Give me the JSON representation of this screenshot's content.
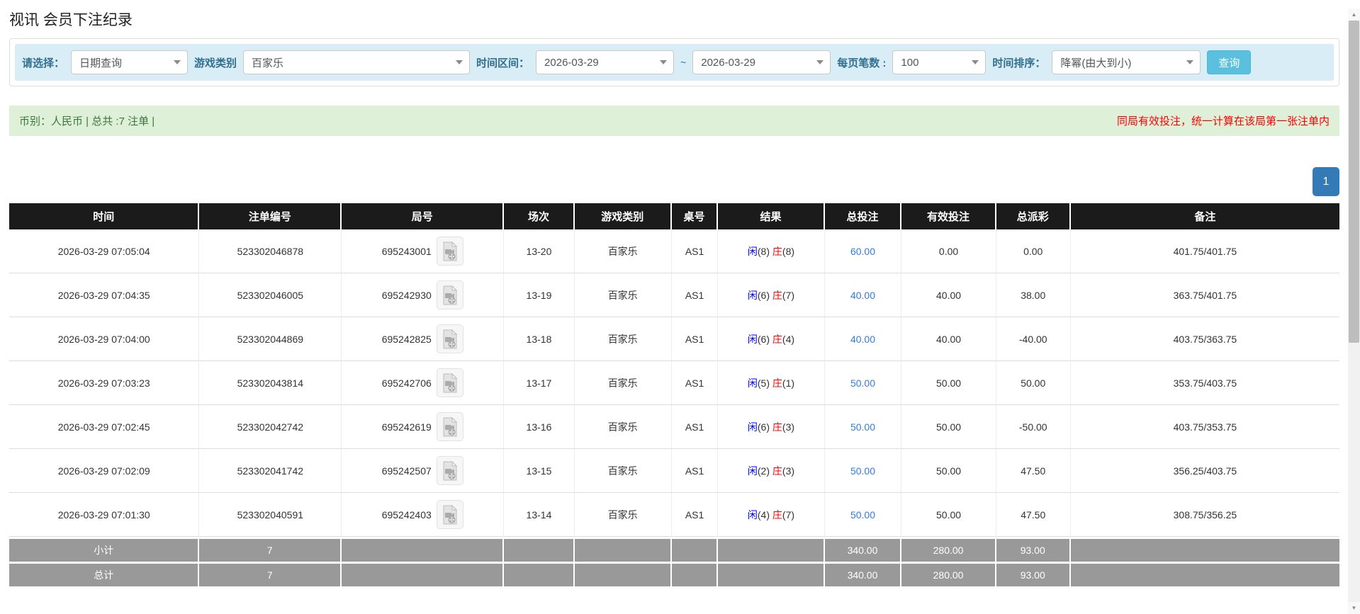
{
  "page_title": "视讯 会员下注纪录",
  "filters": {
    "query_type": {
      "label": "请选择：",
      "value": "日期查询"
    },
    "game_category": {
      "label": "游戏类别",
      "value": "百家乐"
    },
    "date_range": {
      "label": "时间区间：",
      "from": "2026-03-29",
      "separator": "~",
      "to": "2026-03-29"
    },
    "page_size": {
      "label": "每页笔数 :",
      "value": "100"
    },
    "time_sort": {
      "label": "时间排序：",
      "value": "降幂(由大到小)"
    },
    "search_button": "查询"
  },
  "summary": {
    "currency_text": "币别：人民币 | 总共 :7 注单 |",
    "notice": "同局有效投注，统一计算在该局第一张注单内"
  },
  "pagination": {
    "current_page": "1"
  },
  "colors": {
    "accent_blue": "#337ab7",
    "search_button_blue": "#5bc0de",
    "player_blue": "#0000ff",
    "banker_red": "#ff0000",
    "negative_red": "#ff0000",
    "success_green": "#3c763d",
    "header_black": "#1b1b1b",
    "totals_gray": "#999999",
    "filter_bar_blue": "#d9edf7",
    "summary_bar_green": "#dff0d8"
  },
  "table": {
    "columns": [
      "时间",
      "注单编号",
      "局号",
      "场次",
      "游戏类别",
      "桌号",
      "结果",
      "总投注",
      "有效投注",
      "总派彩",
      "备注"
    ],
    "result_labels": {
      "player": "闲",
      "banker": "庄"
    },
    "rows": [
      {
        "time": "2026-03-29 07:05:04",
        "bet_no": "523302046878",
        "round_no": "695243001",
        "session": "13-20",
        "game": "百家乐",
        "table_no": "AS1",
        "player": "8",
        "banker": "8",
        "total_bet": "60.00",
        "valid_bet": "0.00",
        "payout": "0.00",
        "note": "401.75/401.75"
      },
      {
        "time": "2026-03-29 07:04:35",
        "bet_no": "523302046005",
        "round_no": "695242930",
        "session": "13-19",
        "game": "百家乐",
        "table_no": "AS1",
        "player": "6",
        "banker": "7",
        "total_bet": "40.00",
        "valid_bet": "40.00",
        "payout": "38.00",
        "note": "363.75/401.75"
      },
      {
        "time": "2026-03-29 07:04:00",
        "bet_no": "523302044869",
        "round_no": "695242825",
        "session": "13-18",
        "game": "百家乐",
        "table_no": "AS1",
        "player": "6",
        "banker": "4",
        "total_bet": "40.00",
        "valid_bet": "40.00",
        "payout": "-40.00",
        "note": "403.75/363.75"
      },
      {
        "time": "2026-03-29 07:03:23",
        "bet_no": "523302043814",
        "round_no": "695242706",
        "session": "13-17",
        "game": "百家乐",
        "table_no": "AS1",
        "player": "5",
        "banker": "1",
        "total_bet": "50.00",
        "valid_bet": "50.00",
        "payout": "50.00",
        "note": "353.75/403.75"
      },
      {
        "time": "2026-03-29 07:02:45",
        "bet_no": "523302042742",
        "round_no": "695242619",
        "session": "13-16",
        "game": "百家乐",
        "table_no": "AS1",
        "player": "6",
        "banker": "3",
        "total_bet": "50.00",
        "valid_bet": "50.00",
        "payout": "-50.00",
        "note": "403.75/353.75"
      },
      {
        "time": "2026-03-29 07:02:09",
        "bet_no": "523302041742",
        "round_no": "695242507",
        "session": "13-15",
        "game": "百家乐",
        "table_no": "AS1",
        "player": "2",
        "banker": "3",
        "total_bet": "50.00",
        "valid_bet": "50.00",
        "payout": "47.50",
        "note": "356.25/403.75"
      },
      {
        "time": "2026-03-29 07:01:30",
        "bet_no": "523302040591",
        "round_no": "695242403",
        "session": "13-14",
        "game": "百家乐",
        "table_no": "AS1",
        "player": "4",
        "banker": "7",
        "total_bet": "50.00",
        "valid_bet": "50.00",
        "payout": "47.50",
        "note": "308.75/356.25"
      }
    ],
    "totals": [
      {
        "label": "小计",
        "count": "7",
        "total_bet": "340.00",
        "valid_bet": "280.00",
        "payout": "93.00"
      },
      {
        "label": "总计",
        "count": "7",
        "total_bet": "340.00",
        "valid_bet": "280.00",
        "payout": "93.00"
      }
    ]
  }
}
